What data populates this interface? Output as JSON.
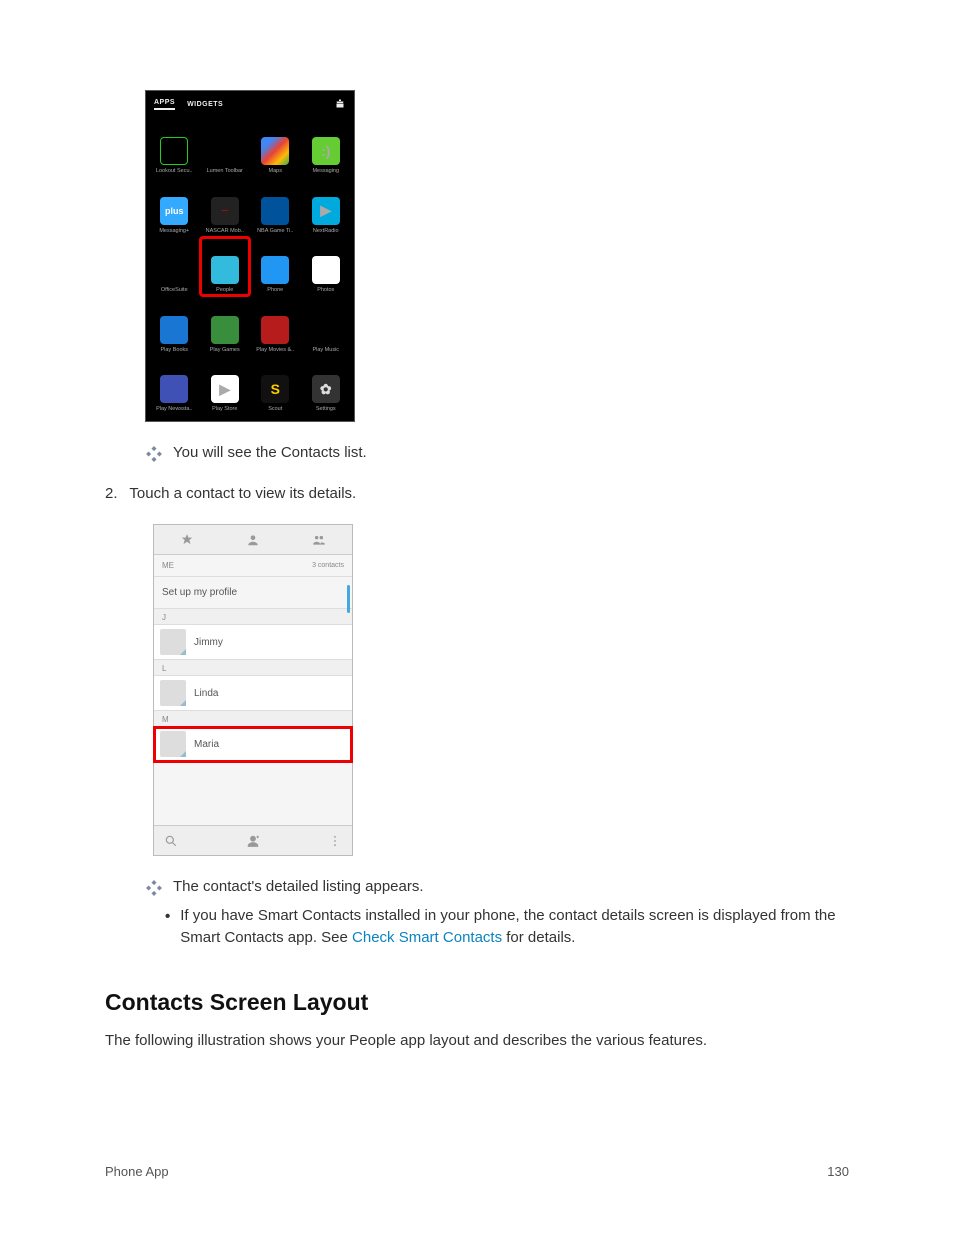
{
  "apps_screen": {
    "tabs": {
      "apps": "APPS",
      "widgets": "WIDGETS"
    },
    "items": [
      {
        "label": "Lookout Secu..",
        "iconClass": "i-lookout",
        "glyph": ""
      },
      {
        "label": "Lumen Toolbar",
        "iconClass": "i-lumen",
        "glyph": ""
      },
      {
        "label": "Maps",
        "iconClass": "i-maps",
        "glyph": ""
      },
      {
        "label": "Messaging",
        "iconClass": "i-msg",
        "glyph": ":)"
      },
      {
        "label": "Messaging+",
        "iconClass": "i-msgplus",
        "glyph": "plus"
      },
      {
        "label": "NASCAR Mob..",
        "iconClass": "i-nascar",
        "glyph": "—"
      },
      {
        "label": "NBA Game Ti..",
        "iconClass": "i-nba",
        "glyph": ""
      },
      {
        "label": "NextRadio",
        "iconClass": "i-nextradio",
        "glyph": "▶"
      },
      {
        "label": "OfficeSuite",
        "iconClass": "i-office",
        "glyph": ""
      },
      {
        "label": "People",
        "iconClass": "i-people",
        "glyph": "",
        "highlighted": true
      },
      {
        "label": "Phone",
        "iconClass": "i-phone",
        "glyph": ""
      },
      {
        "label": "Photos",
        "iconClass": "i-photos",
        "glyph": ""
      },
      {
        "label": "Play Books",
        "iconClass": "i-pbooks",
        "glyph": ""
      },
      {
        "label": "Play Games",
        "iconClass": "i-pgames",
        "glyph": ""
      },
      {
        "label": "Play Movies &..",
        "iconClass": "i-pmovies",
        "glyph": ""
      },
      {
        "label": "Play Music",
        "iconClass": "i-pmusic",
        "glyph": ""
      },
      {
        "label": "Play Newssta..",
        "iconClass": "i-pnews",
        "glyph": ""
      },
      {
        "label": "Play Store",
        "iconClass": "i-pstore",
        "glyph": "▶"
      },
      {
        "label": "Scout",
        "iconClass": "i-scout",
        "glyph": "S"
      },
      {
        "label": "Settings",
        "iconClass": "i-settings",
        "glyph": "✿"
      }
    ]
  },
  "text": {
    "bullet1": "You will see the Contacts list.",
    "step2_num": "2.",
    "step2": "Touch a contact to view its details.",
    "bullet2": "The contact's detailed listing appears.",
    "sub_prefix": "If you have Smart Contacts installed in your phone, the contact details screen is displayed from the Smart Contacts app. See ",
    "sub_link": "Check Smart Contacts",
    "sub_suffix": " for details.",
    "heading": "Contacts Screen Layout",
    "desc": "The following illustration shows your People app layout and describes the various features."
  },
  "contacts_screen": {
    "me_label": "ME",
    "count": "3 contacts",
    "setup": "Set up my profile",
    "sections": [
      {
        "letter": "J",
        "rows": [
          {
            "name": "Jimmy"
          }
        ]
      },
      {
        "letter": "L",
        "rows": [
          {
            "name": "Linda"
          }
        ]
      },
      {
        "letter": "M",
        "rows": [
          {
            "name": "Maria",
            "highlighted": true
          }
        ]
      }
    ]
  },
  "footer": {
    "left": "Phone App",
    "page": "130"
  }
}
